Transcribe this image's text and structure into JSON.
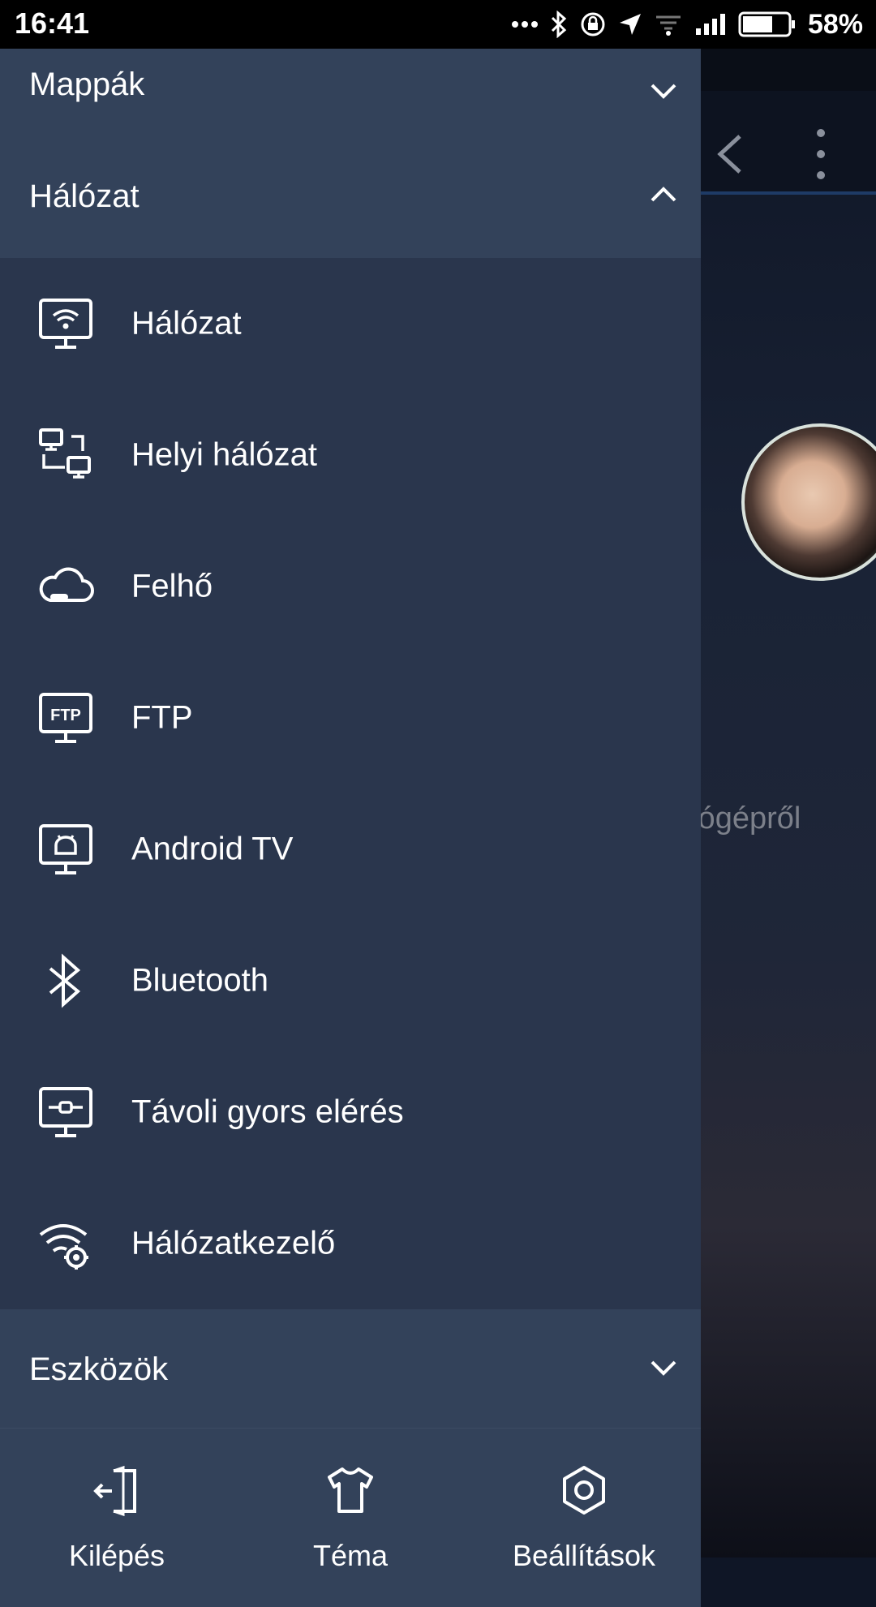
{
  "status_bar": {
    "time": "16:41",
    "battery": "58%",
    "icons": [
      "more-dots-icon",
      "bluetooth-icon",
      "rotation-lock-icon",
      "location-icon",
      "wifi-icon",
      "signal-icon",
      "battery-icon"
    ]
  },
  "background_app": {
    "hint_text": "tógépről"
  },
  "drawer": {
    "sections": {
      "folders": {
        "title": "Mappák",
        "expanded": false
      },
      "network": {
        "title": "Hálózat",
        "expanded": true
      },
      "tools": {
        "title": "Eszközök",
        "expanded": false
      }
    },
    "network_items": [
      {
        "label": "Hálózat",
        "icon": "network-monitor-icon"
      },
      {
        "label": "Helyi hálózat",
        "icon": "lan-icon"
      },
      {
        "label": "Felhő",
        "icon": "cloud-icon"
      },
      {
        "label": "FTP",
        "icon": "ftp-icon"
      },
      {
        "label": "Android TV",
        "icon": "android-tv-icon"
      },
      {
        "label": "Bluetooth",
        "icon": "bluetooth-icon"
      },
      {
        "label": "Távoli gyors elérés",
        "icon": "remote-access-icon"
      },
      {
        "label": "Hálózatkezelő",
        "icon": "network-manager-icon"
      }
    ]
  },
  "bottom_bar": {
    "exit": "Kilépés",
    "theme": "Téma",
    "settings": "Beállítások"
  },
  "colors": {
    "drawer_bg": "#2a364d",
    "section_bg": "#33425a",
    "status_bar_bg": "#000000",
    "text": "#ffffff"
  }
}
